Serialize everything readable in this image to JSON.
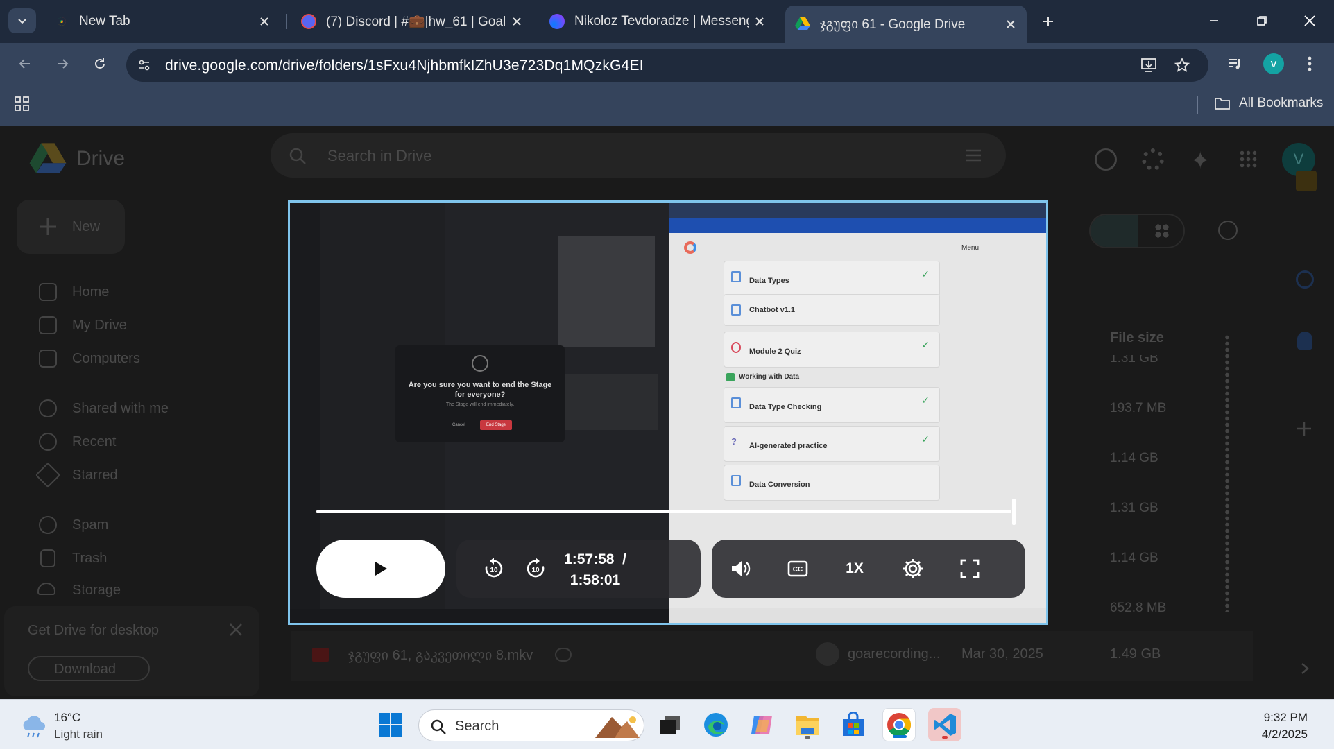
{
  "browser": {
    "tabs": [
      {
        "title": "New Tab",
        "icon": "chrome-icon",
        "active": false
      },
      {
        "title": "(7) Discord | #💼|hw_61 | Goal",
        "icon": "discord-icon",
        "active": false
      },
      {
        "title": "Nikoloz Tevdoradze | Messenger",
        "icon": "messenger-icon",
        "active": false
      },
      {
        "title": "ჯგუფი 61 - Google Drive",
        "icon": "google-drive-icon",
        "active": true
      }
    ],
    "url": "drive.google.com/drive/folders/1sFxu4NjhbmfkIZhU3e723Dq1MQzkG4EI",
    "profile_initial": "v",
    "bookmarks_label": "All Bookmarks"
  },
  "drive": {
    "logo_text": "Drive",
    "search_placeholder": "Search in Drive",
    "new_button": "New",
    "account_initial": "V",
    "nav": [
      {
        "label": "Home",
        "icon": "home-icon"
      },
      {
        "label": "My Drive",
        "icon": "my-drive-icon"
      },
      {
        "label": "Computers",
        "icon": "computer-icon"
      },
      {
        "label": "Shared with me",
        "icon": "people-icon"
      },
      {
        "label": "Recent",
        "icon": "clock-icon"
      },
      {
        "label": "Starred",
        "icon": "star-icon"
      },
      {
        "label": "Spam",
        "icon": "spam-icon"
      },
      {
        "label": "Trash",
        "icon": "trash-icon"
      },
      {
        "label": "Storage",
        "icon": "cloud-icon"
      }
    ],
    "promo_text": "Get Drive for desktop",
    "promo_button": "Download",
    "column_file_size": "File size",
    "sizes": [
      "1.31 GB",
      "193.7 MB",
      "1.14 GB",
      "1.31 GB",
      "1.14 GB",
      "652.8 MB",
      "1.49 GB"
    ],
    "last_file": {
      "name": "ჯგუფი 61, გაკვეთილი 8.mkv",
      "owner": "goarecording...",
      "date": "Mar 30, 2025",
      "size": "1.49 GB"
    }
  },
  "video": {
    "current_time": "1:57:58",
    "separator": "/",
    "duration": "1:58:01",
    "progress": 0.9996,
    "speed": "1X",
    "controls": {
      "play": "play-icon",
      "rewind": "rewind-10-icon",
      "forward": "forward-10-icon",
      "volume": "volume-icon",
      "captions": "closed-captions-icon",
      "settings": "gear-icon",
      "fullscreen": "fullscreen-icon"
    },
    "frame": {
      "dialog_title": "Are you sure you want to end the Stage for everyone?",
      "dialog_sub": "The Stage will end immediately.",
      "dialog_cancel": "Cancel",
      "dialog_confirm": "End Stage",
      "menu_label": "Menu",
      "lessons": [
        "Data Types",
        "Chatbot v1.1",
        "Module 2 Quiz",
        "Working with Data",
        "Data Type Checking",
        "AI-generated practice",
        "Data Conversion"
      ]
    }
  },
  "taskbar": {
    "weather_temp": "16°C",
    "weather_desc": "Light rain",
    "search_label": "Search",
    "time": "9:32 PM",
    "date": "4/2/2025",
    "apps": [
      "windows-start-icon",
      "task-view-icon",
      "edge-icon",
      "copilot-icon",
      "file-explorer-icon",
      "microsoft-store-icon",
      "chrome-icon",
      "vscode-icon"
    ]
  },
  "colors": {
    "tab_bar": "#1f2a3c",
    "toolbar": "#35445c",
    "player_border": "#7fc4ec",
    "taskbar": "#e9eef5"
  }
}
